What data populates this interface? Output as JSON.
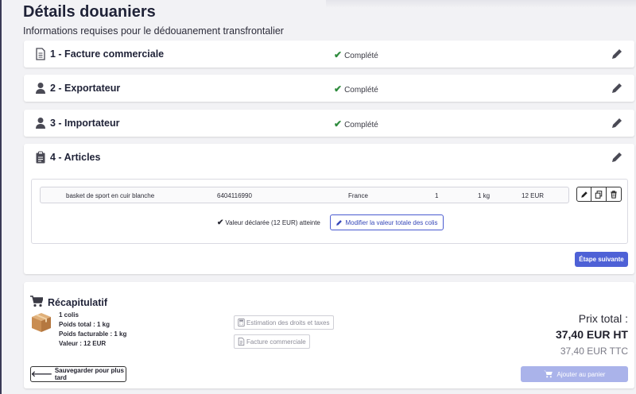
{
  "page": {
    "title": "Détails douaniers",
    "subtitle": "Informations requises pour le dédouanement transfrontalier"
  },
  "steps": [
    {
      "label": "1 - Facture commerciale",
      "status": "Complété",
      "icon": "document-icon"
    },
    {
      "label": "2 - Exportateur",
      "status": "Complété",
      "icon": "user-icon"
    },
    {
      "label": "3 - Importateur",
      "status": "Complété",
      "icon": "user-icon"
    },
    {
      "label": "4 - Articles",
      "status": "",
      "icon": "clipboard-icon"
    }
  ],
  "articles": {
    "rows": [
      {
        "description": "basket de sport en cuir blanche",
        "hs_code": "6404116990",
        "origin": "France",
        "quantity": "1",
        "weight": "1 kg",
        "value": "12 EUR"
      }
    ],
    "declared_message": "Valeur déclarée (12 EUR) atteinte",
    "modify_label": "Modifier la valeur totale des colis",
    "next_label": "Étape suivante"
  },
  "summary": {
    "title": "Récapitulatif",
    "parcels": "1 colis",
    "total_weight": "Poids total : 1 kg",
    "billable_weight": "Poids facturable : 1 kg",
    "value": "Valeur : 12 EUR",
    "estimate_label": "Estimation des droits et taxes",
    "invoice_label": "Facture commerciale",
    "price_label": "Prix total :",
    "price_ht": "37,40 EUR HT",
    "price_ttc": "37,40 EUR TTC",
    "save_label": "Sauvegarder pour plus tard",
    "add_cart_label": "Ajouter au panier"
  },
  "colors": {
    "accent": "#4e61d6",
    "accent_disabled": "#aab3ea",
    "success": "#2e8b3d"
  }
}
